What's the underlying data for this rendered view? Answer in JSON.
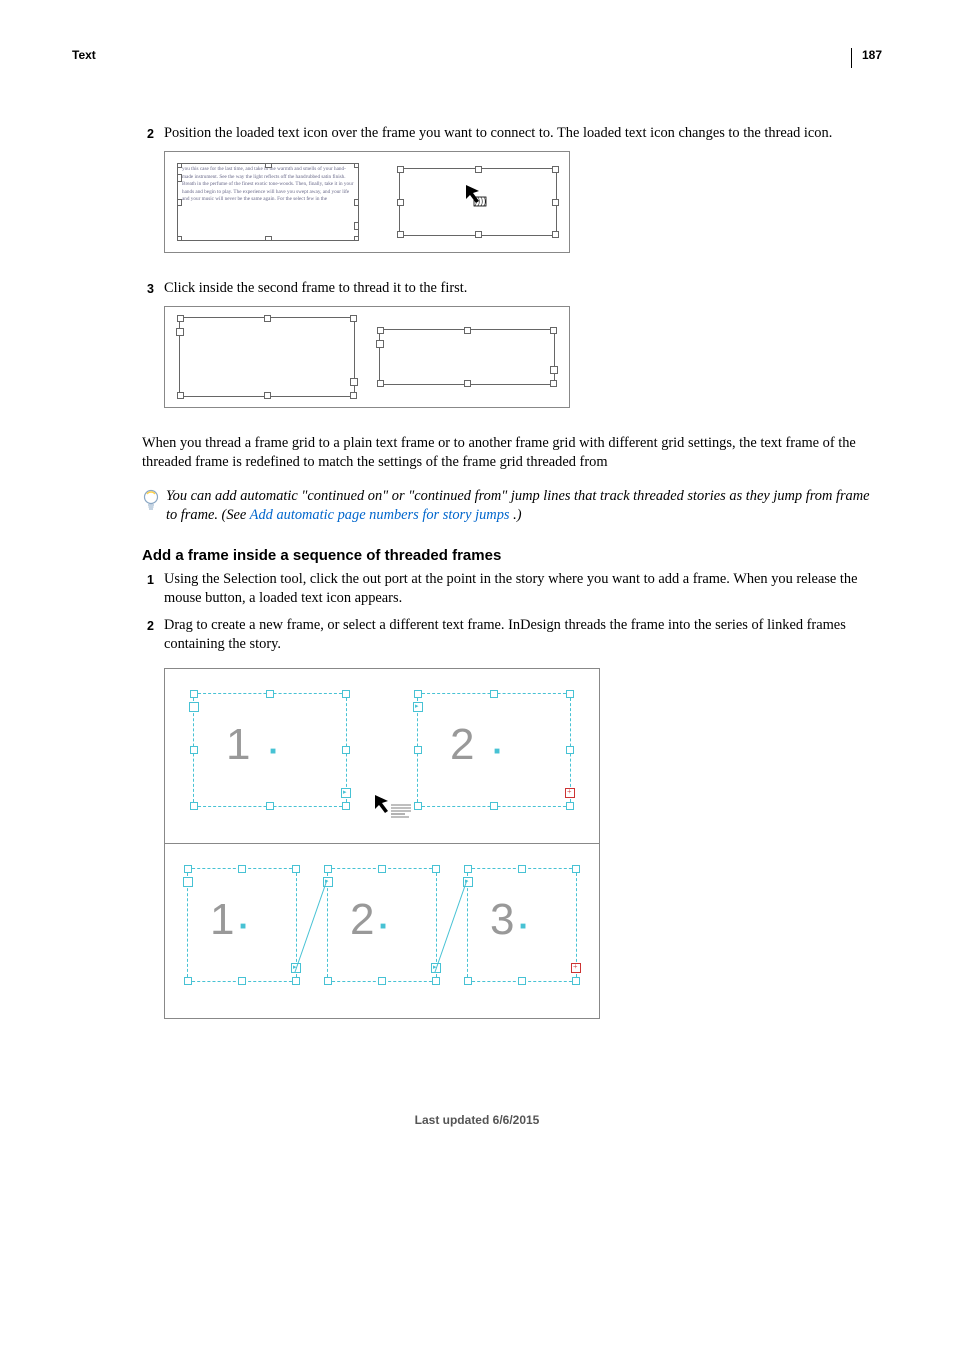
{
  "header": {
    "section_label": "Text",
    "page_number": "187"
  },
  "step2": {
    "num": "2",
    "text": "Position the loaded text icon over the frame you want to connect to. The loaded text icon changes to the thread icon."
  },
  "fig1_filler": "you this case for the last time, and take in the warmth and smells of your hand-made instrument. See the way the light reflects off the handrubbed satin finish. Breath in the perfume of the finest exotic tone-woods. Then, finally, take it in your hands and begin to play. The experience will have you swept away, and your life and your music will never be the same again. For the select few in the",
  "step3": {
    "num": "3",
    "text": "Click inside the second frame to thread it to the first."
  },
  "threading_para": "When you thread a frame grid to a plain text frame or to another frame grid with different grid settings, the text frame of the threaded frame is redefined to match the settings of the frame grid threaded from",
  "tip_text_1": "You can add automatic \"continued on\" or \"continued from\" jump lines that track threaded stories as they jump from frame to frame. (See ",
  "tip_link": "Add automatic page numbers for story jumps",
  "tip_text_2": " .)",
  "section_heading": "Add a frame inside a sequence of threaded frames",
  "seq_step1": {
    "num": "1",
    "text": "Using the Selection tool, click the out port at the point in the story where you want to add a frame. When you release the mouse button, a loaded text icon appears."
  },
  "seq_step2": {
    "num": "2",
    "text": "Drag to create a new frame, or select a different text frame. InDesign threads the frame into the series of linked frames containing the story."
  },
  "diagram_labels": {
    "one": "1",
    "two": "2",
    "three": "3"
  },
  "footer": "Last updated 6/6/2015"
}
